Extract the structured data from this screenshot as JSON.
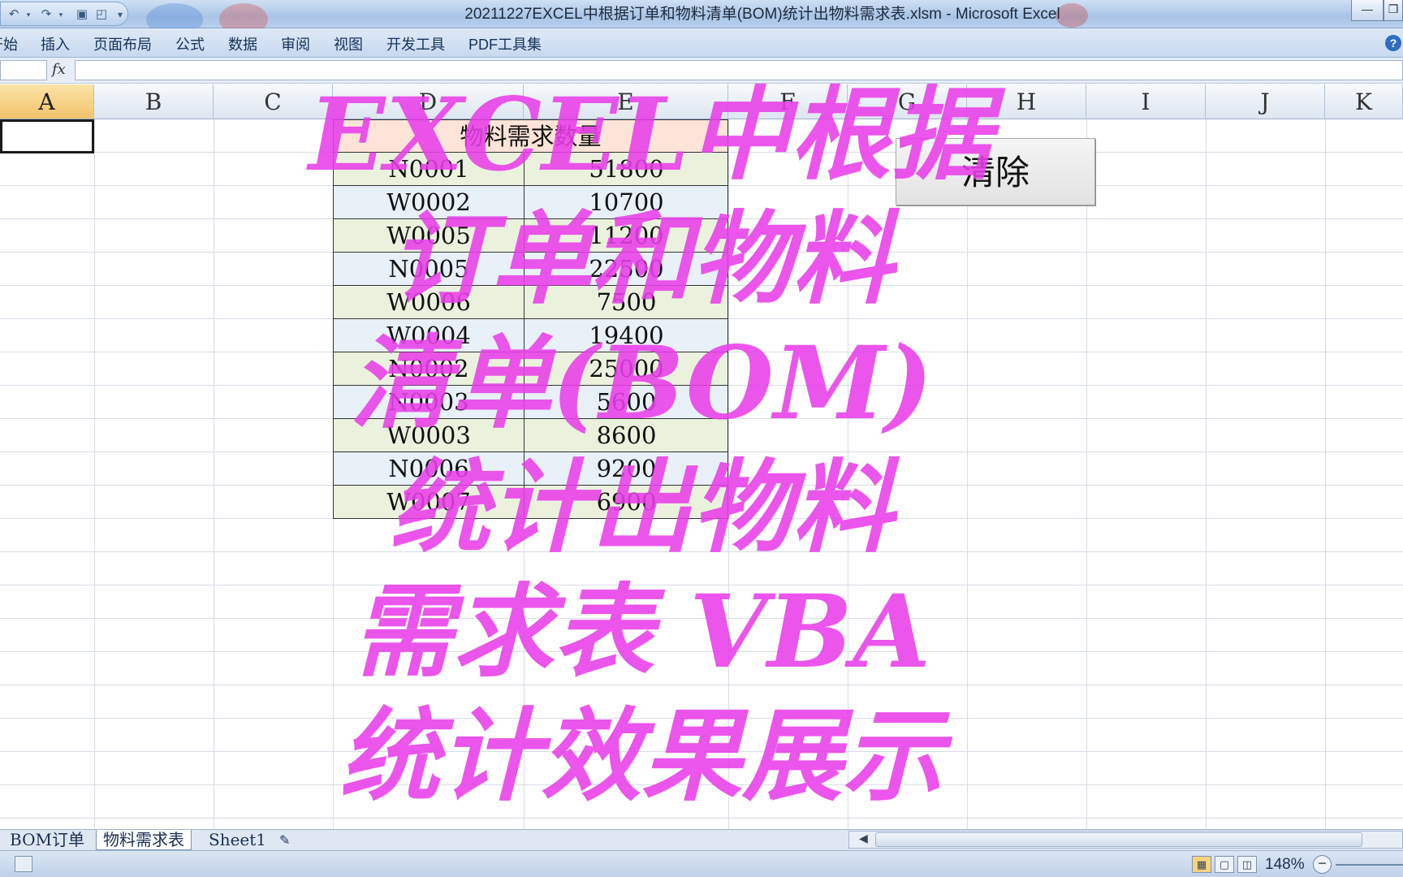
{
  "window": {
    "title": "20211227EXCEL中根据订单和物料清单(BOM)统计出物料需求表.xlsm - Microsoft Excel"
  },
  "ribbon": {
    "tabs": [
      "开始",
      "插入",
      "页面布局",
      "公式",
      "数据",
      "审阅",
      "视图",
      "开发工具",
      "PDF工具集"
    ],
    "visible_first_tab": "开始",
    "help_label": "?"
  },
  "formula_bar": {
    "fx_label": "fx",
    "name_box": "",
    "content": ""
  },
  "columns": [
    "A",
    "B",
    "C",
    "D",
    "E",
    "F",
    "G",
    "H",
    "I",
    "J",
    "K"
  ],
  "selected_cell": "A1",
  "table": {
    "header": "物料需求数量",
    "rows": [
      {
        "material": "N0001",
        "qty": "51800"
      },
      {
        "material": "W0002",
        "qty": "10700"
      },
      {
        "material": "W0005",
        "qty": "11200"
      },
      {
        "material": "N0005",
        "qty": "22500"
      },
      {
        "material": "W0006",
        "qty": "7500"
      },
      {
        "material": "W0004",
        "qty": "19400"
      },
      {
        "material": "N0002",
        "qty": "25000"
      },
      {
        "material": "N0003",
        "qty": "5600"
      },
      {
        "material": "W0003",
        "qty": "8600"
      },
      {
        "material": "N0006",
        "qty": "9200"
      },
      {
        "material": "W0007",
        "qty": "6900"
      }
    ]
  },
  "clear_button": {
    "label": "清除"
  },
  "overlay_caption": {
    "lines": [
      "EXCEL中根据",
      "订单和物料",
      "清单(BOM)",
      "统计出物料",
      "需求表 VBA",
      "统计效果展示"
    ],
    "color": "#e83ee8"
  },
  "sheet_tabs": {
    "tabs": [
      "BOM",
      "订单",
      "物料需求表",
      "Sheet1"
    ],
    "active": "物料需求表"
  },
  "status_bar": {
    "zoom": "148%"
  }
}
